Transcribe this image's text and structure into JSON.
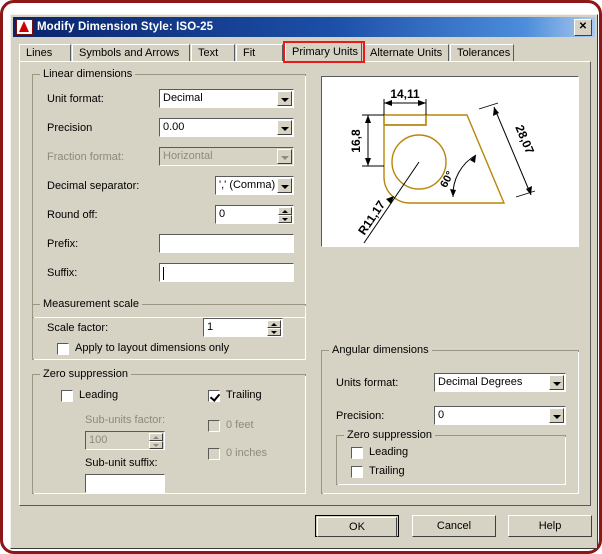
{
  "window": {
    "title": "Modify Dimension Style: ISO-25",
    "close_label": "✕",
    "logo_icon": "autocad-logo-icon"
  },
  "tabs": [
    {
      "label": "Lines",
      "active": false
    },
    {
      "label": "Symbols and Arrows",
      "active": false
    },
    {
      "label": "Text",
      "active": false
    },
    {
      "label": "Fit",
      "active": false
    },
    {
      "label": "Primary Units",
      "active": true
    },
    {
      "label": "Alternate Units",
      "active": false
    },
    {
      "label": "Tolerances",
      "active": false
    }
  ],
  "linear": {
    "group_title": "Linear dimensions",
    "unit_format": {
      "label": "Unit format:",
      "value": "Decimal"
    },
    "precision": {
      "label": "Precision",
      "value": "0.00"
    },
    "fraction_format": {
      "label": "Fraction format:",
      "value": "Horizontal"
    },
    "decimal_separator": {
      "label": "Decimal separator:",
      "value": "',' (Comma)"
    },
    "round_off": {
      "label": "Round off:",
      "value": "0"
    },
    "prefix": {
      "label": "Prefix:",
      "value": ""
    },
    "suffix": {
      "label": "Suffix:",
      "value": ""
    }
  },
  "measurement_scale": {
    "group_title": "Measurement scale",
    "scale_factor": {
      "label": "Scale factor:",
      "value": "1"
    },
    "apply_layout_only": {
      "label": "Apply to layout dimensions only",
      "checked": false
    }
  },
  "zero_suppression_linear": {
    "group_title": "Zero suppression",
    "leading": {
      "label": "Leading",
      "checked": false
    },
    "trailing": {
      "label": "Trailing",
      "checked": true
    },
    "sub_units_factor": {
      "label": "Sub-units factor:",
      "value": "100"
    },
    "sub_unit_suffix": {
      "label": "Sub-unit suffix:",
      "value": ""
    },
    "zero_feet": {
      "label": "0 feet",
      "checked": false
    },
    "zero_inches": {
      "label": "0 inches",
      "checked": false
    }
  },
  "angular": {
    "group_title": "Angular dimensions",
    "units_format": {
      "label": "Units format:",
      "value": "Decimal Degrees"
    },
    "precision": {
      "label": "Precision:",
      "value": "0"
    },
    "zero_suppression": {
      "group_title": "Zero suppression",
      "leading": {
        "label": "Leading",
        "checked": false
      },
      "trailing": {
        "label": "Trailing",
        "checked": false
      }
    }
  },
  "preview": {
    "name": "dimension-style-preview",
    "dimensions": {
      "top_linear": "14,11",
      "left_linear": "16,8",
      "diagonal_linear": "28,07",
      "radius": "R11,17",
      "angle": "60°"
    },
    "colors": {
      "geometry": "#b8860b",
      "dimension": "#000000",
      "background": "#ffffff"
    }
  },
  "buttons": {
    "ok": "OK",
    "cancel": "Cancel",
    "help": "Help"
  },
  "colors": {
    "titlebar_start": "#0a246a",
    "titlebar_end": "#a9c9ef",
    "dialog_face": "#d6d2c4",
    "highlight_red": "#e81a1a",
    "frame_red": "#8d1616"
  }
}
